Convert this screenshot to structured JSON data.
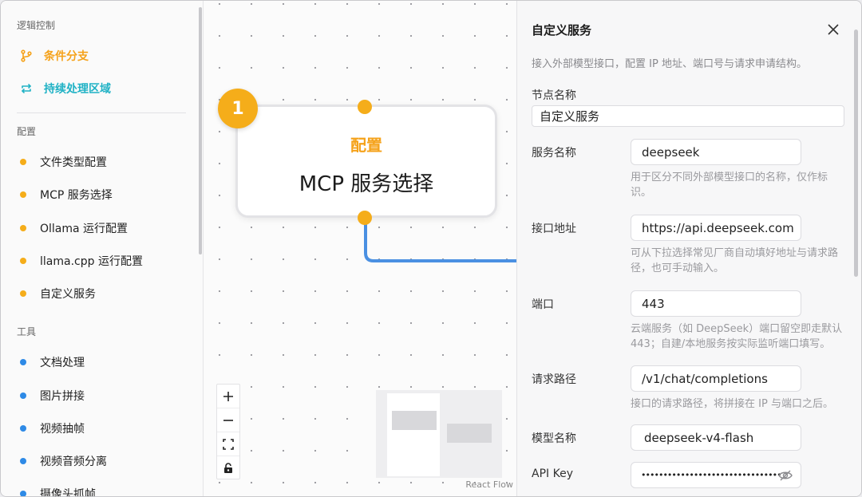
{
  "sidebar": {
    "logic_title": "逻辑控制",
    "logic_items": [
      {
        "label": "条件分支",
        "color": "#f5a21a",
        "icon": "branch-icon"
      },
      {
        "label": "持续处理区域",
        "color": "#20b2c5",
        "icon": "loop-icon"
      }
    ],
    "config_title": "配置",
    "config_items": [
      {
        "label": "文件类型配置"
      },
      {
        "label": "MCP 服务选择"
      },
      {
        "label": "Ollama 运行配置"
      },
      {
        "label": "llama.cpp 运行配置"
      },
      {
        "label": "自定义服务"
      }
    ],
    "config_color": "#f5ad1a",
    "tools_title": "工具",
    "tools_items": [
      {
        "label": "文档处理"
      },
      {
        "label": "图片拼接"
      },
      {
        "label": "视频抽帧"
      },
      {
        "label": "视频音频分离"
      },
      {
        "label": "摄像头抓帧"
      }
    ],
    "tools_color": "#2e8ae6"
  },
  "canvas": {
    "node": {
      "badge": "1",
      "category": "配置",
      "title": "MCP 服务选择"
    },
    "edge_color": "#4a90e2",
    "controls": {
      "zoom_in": "+",
      "zoom_out": "−"
    },
    "attribution": "React Flow"
  },
  "panel": {
    "title": "自定义服务",
    "description": "接入外部模型接口，配置 IP 地址、端口号与请求申请结构。",
    "node_name_label": "节点名称",
    "node_name_value": "自定义服务",
    "service_name_label": "服务名称",
    "service_name_value": "deepseek",
    "service_name_hint": "用于区分不同外部模型接口的名称，仅作标识。",
    "endpoint_label": "接口地址",
    "endpoint_value": "https://api.deepseek.com",
    "endpoint_hint": "可从下拉选择常见厂商自动填好地址与请求路径，也可手动输入。",
    "port_label": "端口",
    "port_value": "443",
    "port_hint": "云端服务（如 DeepSeek）端口留空即走默认 443；自建/本地服务按实际监听端口填写。",
    "path_label": "请求路径",
    "path_value": "/v1/chat/completions",
    "path_hint": "接口的请求路径，将拼接在 IP 与端口之后。",
    "model_label": "模型名称",
    "model_value": "deepseek-v4-flash",
    "apikey_label": "API Key",
    "apikey_value": "••••••••••••••••••••••••••••••••"
  }
}
